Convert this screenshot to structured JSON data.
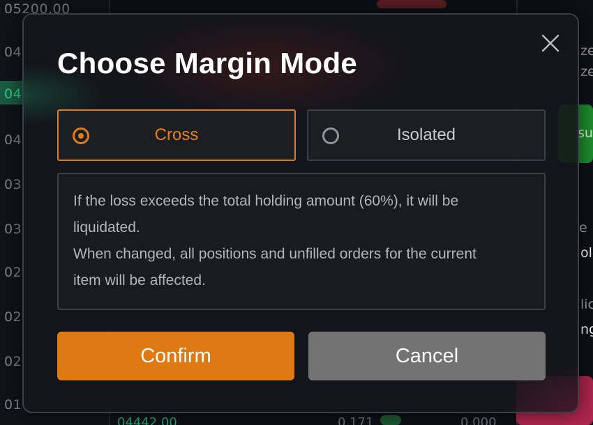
{
  "background": {
    "prices": [
      {
        "text": "05200.00",
        "green": false
      },
      {
        "text": "04",
        "green": false
      },
      {
        "text": "04",
        "green": true
      },
      {
        "text": "04",
        "green": false
      },
      {
        "text": "03",
        "green": false
      },
      {
        "text": "03",
        "green": false
      },
      {
        "text": "02",
        "green": false
      },
      {
        "text": "02",
        "green": false
      },
      {
        "text": "02",
        "green": false
      },
      {
        "text": "01",
        "green": false
      }
    ],
    "right_texts": [
      {
        "text": "ze"
      },
      {
        "text": "ze"
      },
      {
        "text": "su"
      },
      {
        "text": "e"
      },
      {
        "text": "ole"
      },
      {
        "text": "lic"
      },
      {
        "text": "nge"
      }
    ],
    "bottom_texts": [
      {
        "text": "04442.00",
        "green": true
      },
      {
        "text": "0.171",
        "green": false
      },
      {
        "text": "0.000",
        "green": false
      }
    ]
  },
  "dialog": {
    "title": "Choose Margin Mode",
    "close_icon": "close-icon",
    "modes": {
      "cross": {
        "label": "Cross",
        "selected": true
      },
      "isolated": {
        "label": "Isolated",
        "selected": false
      }
    },
    "description_lines": [
      "If the loss exceeds the total holding amount (60%), it will be",
      "liquidated.",
      "When changed, all positions and unfilled orders for the current",
      "item will be affected."
    ],
    "confirm_label": "Confirm",
    "cancel_label": "Cancel"
  },
  "colors": {
    "accent": "#de7a14",
    "cancel": "#737373",
    "border": "#3b3f47",
    "positive": "#2bd08a"
  }
}
